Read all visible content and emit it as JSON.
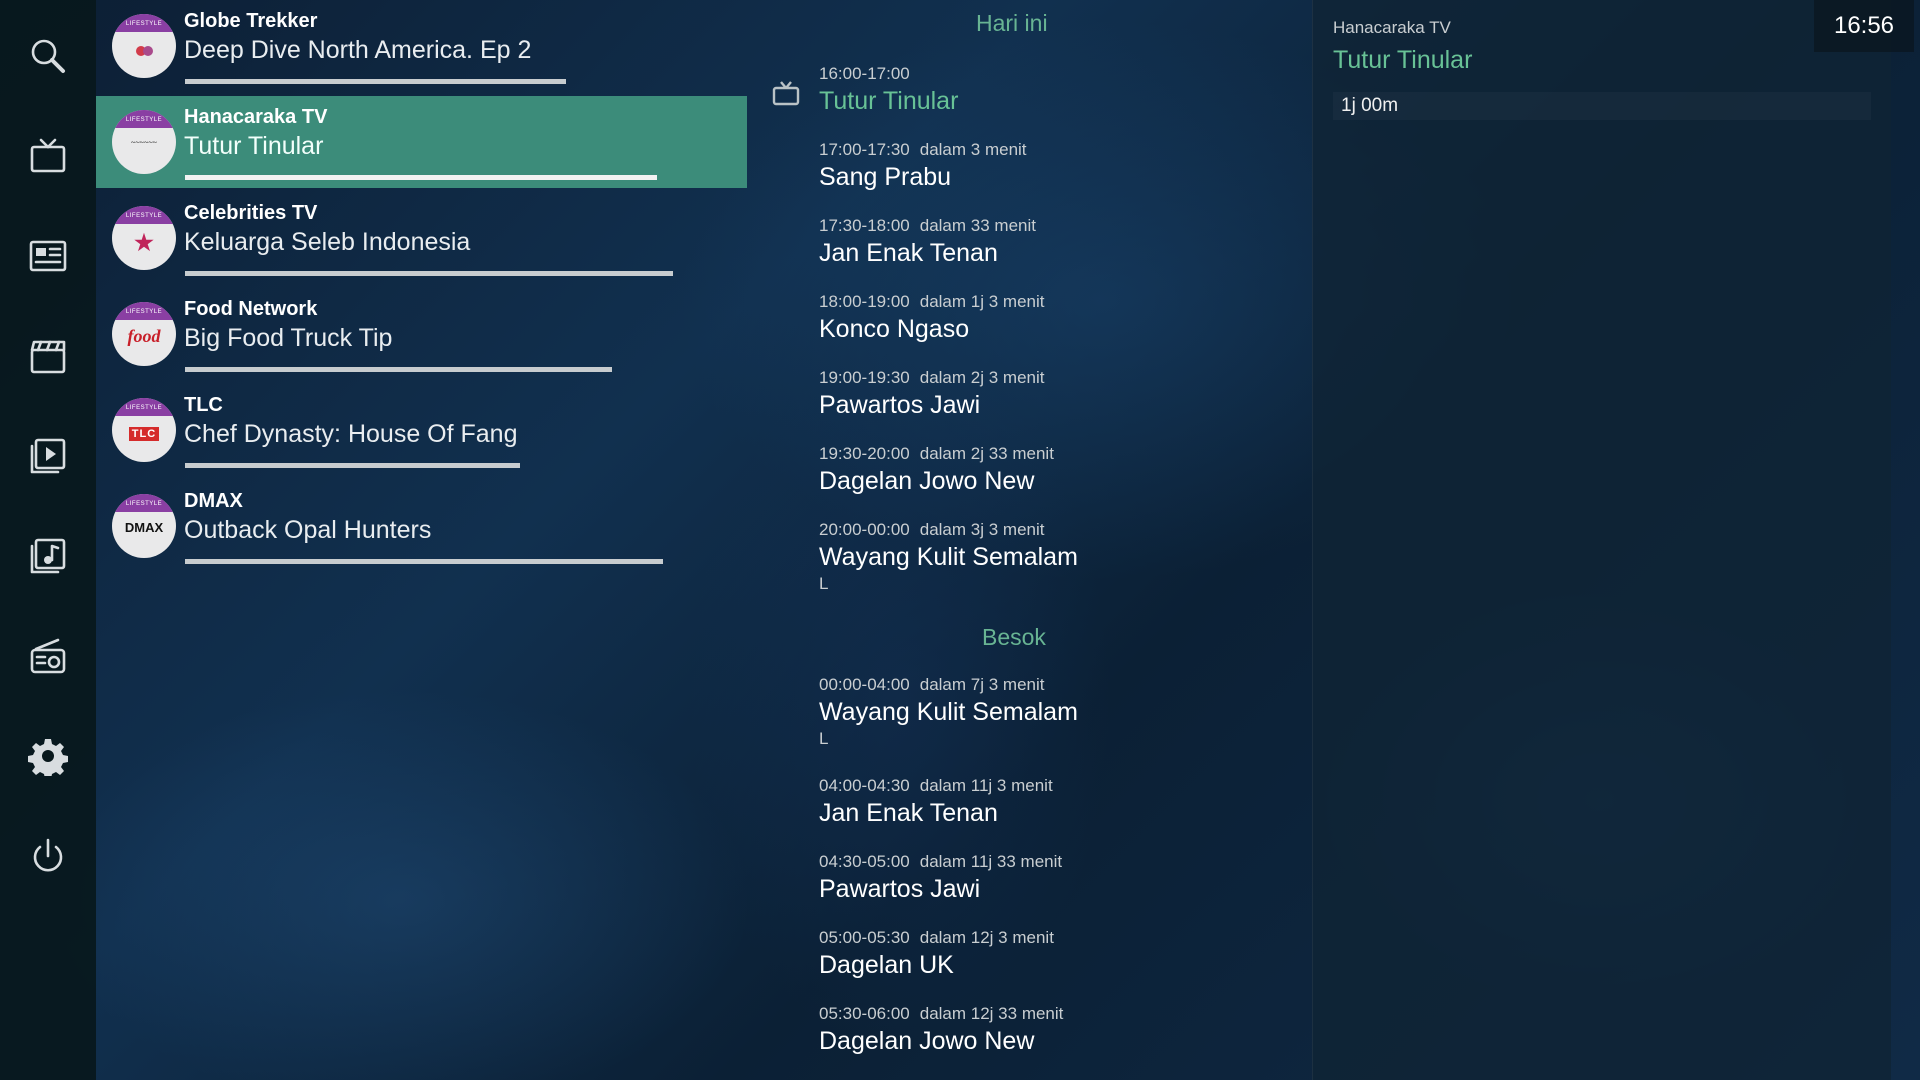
{
  "clock": "16:56",
  "sidebar": {
    "items": [
      {
        "id": "search",
        "icon": "search-icon"
      },
      {
        "id": "tv",
        "icon": "tv-icon"
      },
      {
        "id": "guide",
        "icon": "epg-guide-icon"
      },
      {
        "id": "movies",
        "icon": "clapperboard-icon"
      },
      {
        "id": "videos",
        "icon": "video-play-icon"
      },
      {
        "id": "music",
        "icon": "music-library-icon"
      },
      {
        "id": "radio",
        "icon": "radio-icon"
      },
      {
        "id": "settings",
        "icon": "gear-icon"
      },
      {
        "id": "power",
        "icon": "power-icon"
      }
    ]
  },
  "channels": [
    {
      "name": "Globe Trekker",
      "program": "Deep Dive North America. Ep 2",
      "progress": 0.75,
      "logo_band": "LIFESTYLE",
      "logo_text": "",
      "selected": false
    },
    {
      "name": "Hanacaraka TV",
      "program": "Tutur Tinular",
      "progress": 0.93,
      "logo_band": "LIFESTYLE",
      "logo_text": "",
      "selected": true
    },
    {
      "name": "Celebrities TV",
      "program": "Keluarga Seleb Indonesia",
      "progress": 0.96,
      "logo_band": "LIFESTYLE",
      "logo_text": "",
      "selected": false
    },
    {
      "name": "Food Network",
      "program": "Big Food Truck Tip",
      "progress": 0.84,
      "logo_band": "LIFESTYLE",
      "logo_text": "food",
      "selected": false
    },
    {
      "name": "TLC",
      "program": "Chef Dynasty: House Of Fang",
      "progress": 0.66,
      "logo_band": "LIFESTYLE",
      "logo_text": "TLC",
      "selected": false
    },
    {
      "name": "DMAX",
      "program": "Outback Opal Hunters",
      "progress": 0.94,
      "logo_band": "LIFESTYLE",
      "logo_text": "DMAX",
      "selected": false
    }
  ],
  "schedule": {
    "today_label": "Hari ini",
    "tomorrow_label": "Besok",
    "today": [
      {
        "time": "16:00-17:00",
        "relative": "",
        "title": "Tutur Tinular",
        "flag": "",
        "current": true
      },
      {
        "time": "17:00-17:30",
        "relative": "dalam 3 menit",
        "title": "Sang Prabu",
        "flag": ""
      },
      {
        "time": "17:30-18:00",
        "relative": "dalam 33 menit",
        "title": "Jan Enak Tenan",
        "flag": ""
      },
      {
        "time": "18:00-19:00",
        "relative": "dalam 1j 3 menit",
        "title": "Konco Ngaso",
        "flag": ""
      },
      {
        "time": "19:00-19:30",
        "relative": "dalam 2j 3 menit",
        "title": "Pawartos Jawi",
        "flag": ""
      },
      {
        "time": "19:30-20:00",
        "relative": "dalam 2j 33 menit",
        "title": "Dagelan Jowo New",
        "flag": ""
      },
      {
        "time": "20:00-00:00",
        "relative": "dalam 3j 3 menit",
        "title": "Wayang Kulit Semalam",
        "flag": "L"
      }
    ],
    "tomorrow": [
      {
        "time": "00:00-04:00",
        "relative": "dalam 7j 3 menit",
        "title": "Wayang Kulit Semalam",
        "flag": "L"
      },
      {
        "time": "04:00-04:30",
        "relative": "dalam 11j 3 menit",
        "title": "Jan Enak Tenan",
        "flag": ""
      },
      {
        "time": "04:30-05:00",
        "relative": "dalam 11j 33 menit",
        "title": "Pawartos Jawi",
        "flag": ""
      },
      {
        "time": "05:00-05:30",
        "relative": "dalam 12j 3 menit",
        "title": "Dagelan UK",
        "flag": ""
      },
      {
        "time": "05:30-06:00",
        "relative": "dalam 12j 33 menit",
        "title": "Dagelan Jowo New",
        "flag": ""
      }
    ]
  },
  "detail": {
    "channel": "Hanacaraka TV",
    "title": "Tutur Tinular",
    "duration": "1j 00m"
  }
}
